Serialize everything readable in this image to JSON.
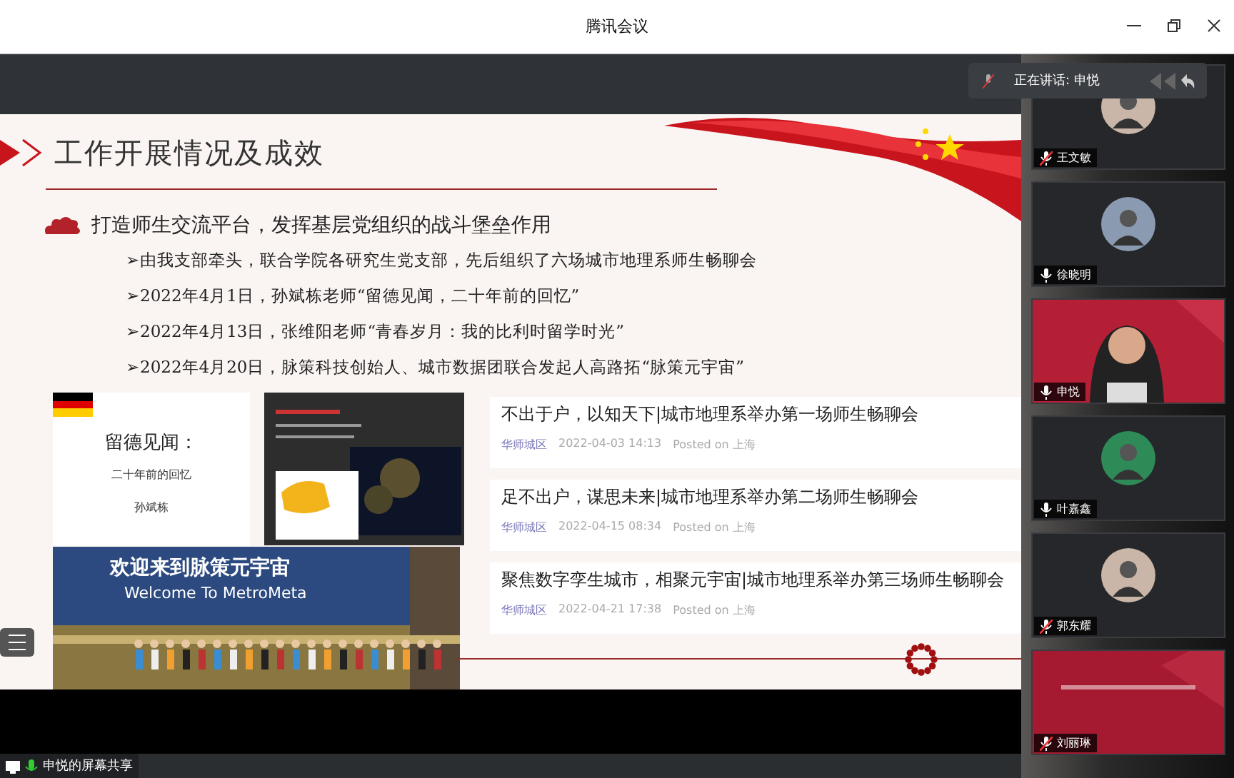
{
  "window": {
    "title": "腾讯会议"
  },
  "speaking": {
    "text": "正在讲话: 申悦"
  },
  "slide": {
    "title": "工作开展情况及成效",
    "subtitle": "打造师生交流平台，发挥基层党组织的战斗堡垒作用",
    "bullets": [
      "➢由我支部牵头，联合学院各研究生党支部，先后组织了六场城市地理系师生畅聊会",
      "➢2022年4月1日，孙斌栋老师“留德见闻，二十年前的回忆”",
      "➢2022年4月13日，张维阳老师“青春岁月：我的比利时留学时光”",
      "➢2022年4月20日，脉策科技创始人、城市数据团联合发起人高路拓“脉策元宇宙”"
    ],
    "doc_thumb": {
      "title": "留德见闻：",
      "subtitle": "二十年前的回忆",
      "author": "孙斌栋"
    },
    "banner": {
      "title": "欢迎来到脉策元宇宙",
      "subtitle": "Welcome To MetroMeta"
    },
    "articles": [
      {
        "title": "不出于户，以知天下|城市地理系举办第一场师生畅聊会",
        "source": "华师城区",
        "date": "2022-04-03 14:13",
        "posted": "Posted on 上海"
      },
      {
        "title": "足不出户，谋思未来|城市地理系举办第二场师生畅聊会",
        "source": "华师城区",
        "date": "2022-04-15 08:34",
        "posted": "Posted on 上海"
      },
      {
        "title": "聚焦数字孪生城市，相聚元宇宙|城市地理系举办第三场师生畅聊会",
        "source": "华师城区",
        "date": "2022-04-21 17:38",
        "posted": "Posted on 上海"
      }
    ]
  },
  "participants": [
    {
      "name": "王文敏",
      "muted": true,
      "kind": "avatar"
    },
    {
      "name": "徐晓明",
      "muted": false,
      "kind": "avatar"
    },
    {
      "name": "申悦",
      "muted": false,
      "kind": "video"
    },
    {
      "name": "叶嘉鑫",
      "muted": false,
      "kind": "avatar"
    },
    {
      "name": "郭东耀",
      "muted": true,
      "kind": "avatar"
    },
    {
      "name": "刘丽琳",
      "muted": true,
      "kind": "screen"
    }
  ],
  "share_label": "申悦的屏幕共享"
}
